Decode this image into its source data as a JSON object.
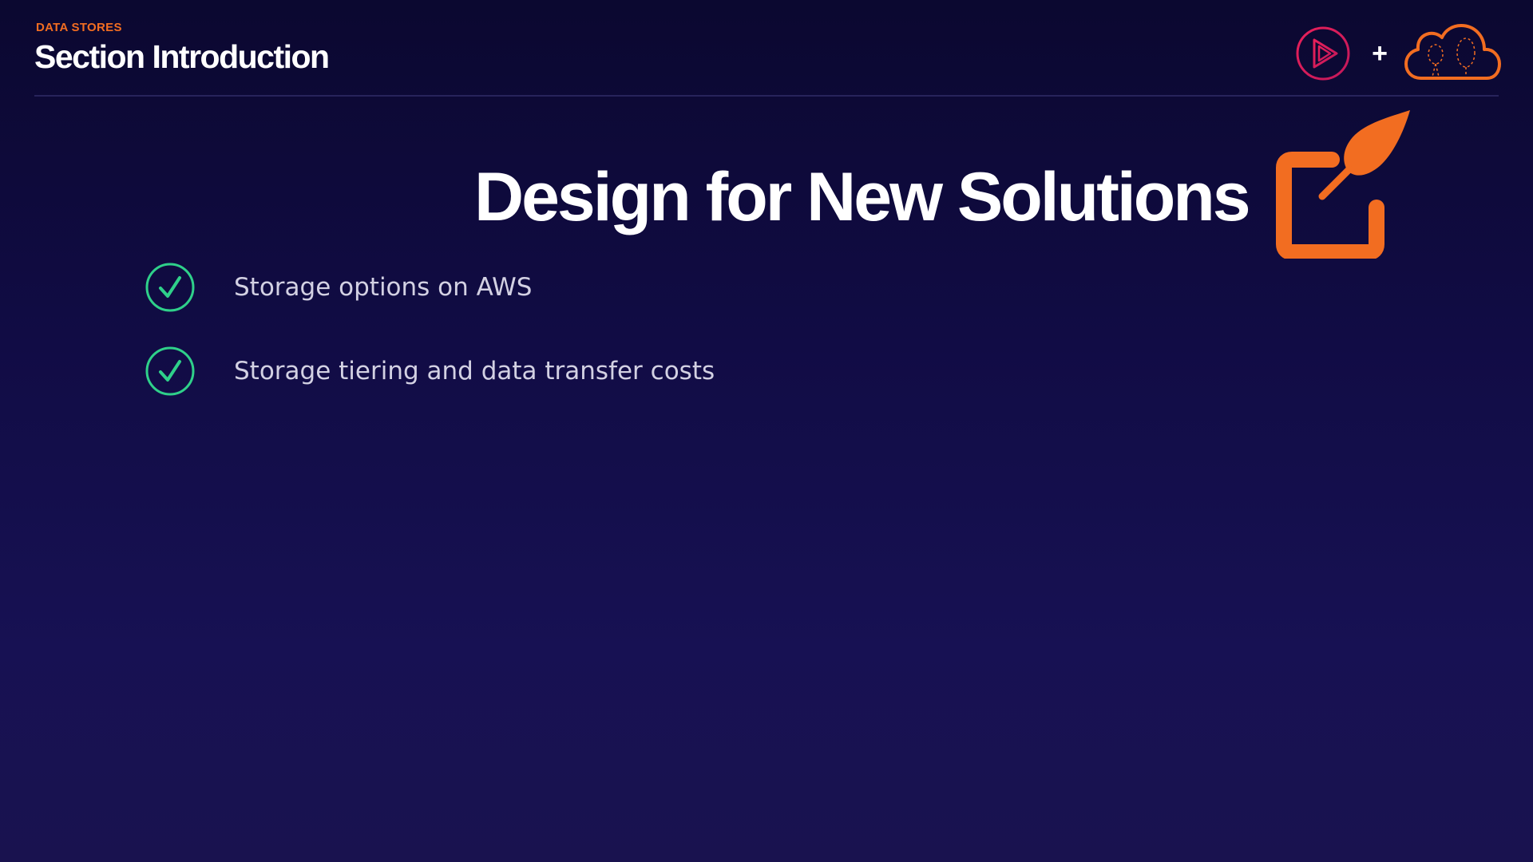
{
  "header": {
    "eyebrow": "DATA STORES",
    "section_title": "Section Introduction",
    "logos": {
      "brand_icon": "play-circle-icon",
      "separator": "+",
      "partner_icon": "cloud-icon"
    }
  },
  "slide": {
    "title": "Design for New Solutions",
    "title_icon": "pencil-edit-icon",
    "bullets": [
      {
        "text": "Storage options on AWS",
        "icon": "checkmark-circle-icon"
      },
      {
        "text": "Storage tiering and data transfer costs",
        "icon": "checkmark-circle-icon"
      }
    ]
  },
  "colors": {
    "background_top": "#0b0830",
    "background_bottom": "#19124f",
    "accent_orange": "#f26d21",
    "brand_pink": "#e0245e",
    "check_green": "#2fd08a",
    "bullet_text": "#d3d1e3",
    "divider": "#27235b"
  }
}
